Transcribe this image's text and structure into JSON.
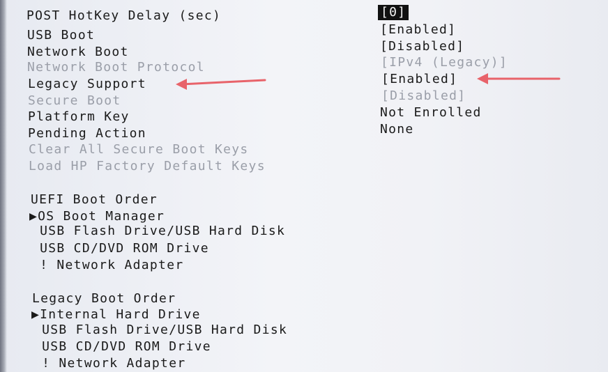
{
  "settings": {
    "post_hotkey_delay": {
      "label": "POST HotKey Delay (sec)",
      "value": "[0]"
    },
    "usb_boot": {
      "label": "USB Boot",
      "value": "[Enabled]"
    },
    "network_boot": {
      "label": "Network Boot",
      "value": "[Disabled]"
    },
    "network_boot_protocol": {
      "label": "Network Boot Protocol",
      "value": "[IPv4 (Legacy)]"
    },
    "legacy_support": {
      "label": "Legacy Support",
      "value": "[Enabled]"
    },
    "secure_boot": {
      "label": "Secure Boot",
      "value": "[Disabled]"
    },
    "platform_key": {
      "label": "Platform Key",
      "value": "Not Enrolled"
    },
    "pending_action": {
      "label": "Pending Action",
      "value": "None"
    },
    "clear_keys": {
      "label": "Clear All Secure Boot Keys"
    },
    "load_hp_keys": {
      "label": "Load HP Factory Default Keys"
    }
  },
  "uefi_boot_order": {
    "title": "UEFI Boot Order",
    "items": [
      "▶OS Boot Manager",
      " USB Flash Drive/USB Hard Disk",
      " USB CD/DVD ROM Drive",
      " ! Network Adapter"
    ]
  },
  "legacy_boot_order": {
    "title": "Legacy Boot Order",
    "items": [
      "▶Internal Hard Drive",
      " USB Flash Drive/USB Hard Disk",
      " USB CD/DVD ROM Drive",
      " ! Network Adapter"
    ]
  },
  "colors": {
    "annotation_arrow": "#e8636a"
  }
}
